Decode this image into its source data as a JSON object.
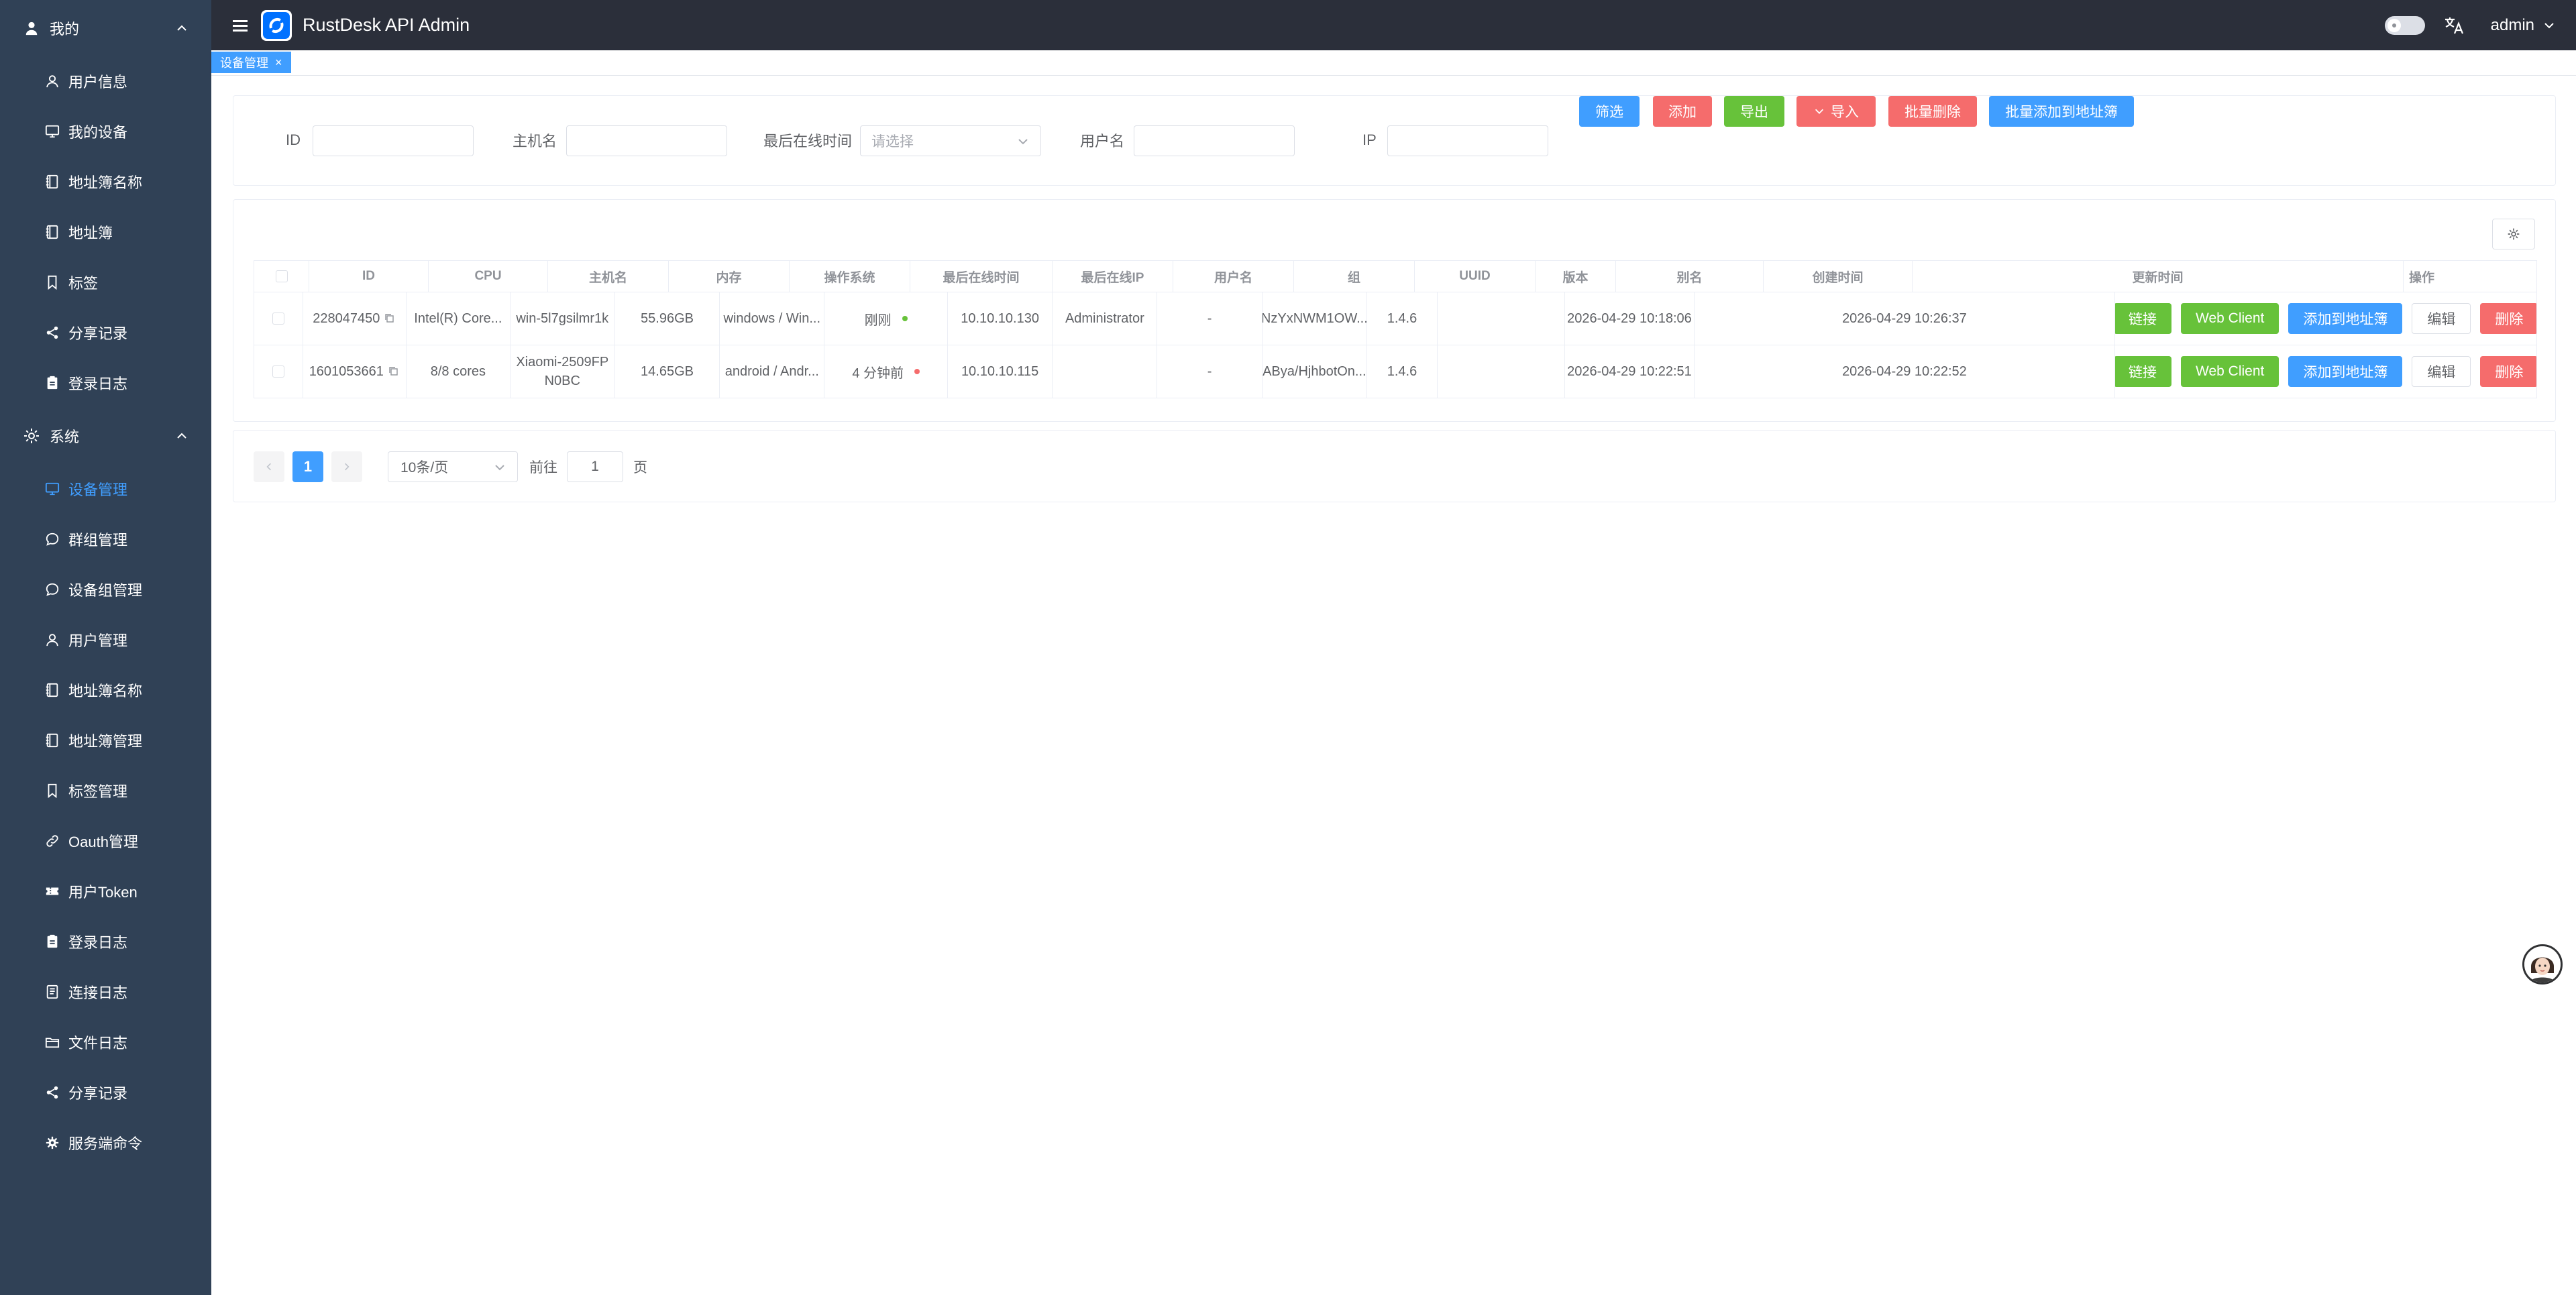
{
  "app": {
    "title": "RustDesk API Admin",
    "user": "admin"
  },
  "sidebar": {
    "group_me": "我的",
    "me_items": [
      {
        "label": "用户信息",
        "icon": "user-icon"
      },
      {
        "label": "我的设备",
        "icon": "monitor-icon"
      },
      {
        "label": "地址簿名称",
        "icon": "notebook-icon"
      },
      {
        "label": "地址簿",
        "icon": "notebook-icon"
      },
      {
        "label": "标签",
        "icon": "collection-tag-icon"
      },
      {
        "label": "分享记录",
        "icon": "share-icon"
      },
      {
        "label": "登录日志",
        "icon": "clipboard-icon"
      }
    ],
    "group_system": "系统",
    "system_items": [
      {
        "label": "设备管理",
        "icon": "monitor-icon",
        "active": true
      },
      {
        "label": "群组管理",
        "icon": "chat-icon"
      },
      {
        "label": "设备组管理",
        "icon": "chat-icon"
      },
      {
        "label": "用户管理",
        "icon": "user-icon"
      },
      {
        "label": "地址簿名称",
        "icon": "notebook-icon"
      },
      {
        "label": "地址簿管理",
        "icon": "notebook-icon"
      },
      {
        "label": "标签管理",
        "icon": "collection-tag-icon"
      },
      {
        "label": "Oauth管理",
        "icon": "link-icon"
      },
      {
        "label": "用户Token",
        "icon": "ticket-icon"
      },
      {
        "label": "登录日志",
        "icon": "clipboard-icon"
      },
      {
        "label": "连接日志",
        "icon": "document-icon"
      },
      {
        "label": "文件日志",
        "icon": "folder-icon"
      },
      {
        "label": "分享记录",
        "icon": "share-icon"
      },
      {
        "label": "服务端命令",
        "icon": "gear-icon"
      }
    ]
  },
  "tags": {
    "active": "设备管理",
    "close": "×"
  },
  "filter": {
    "id_label": "ID",
    "hostname_label": "主机名",
    "last_online_label": "最后在线时间",
    "last_online_placeholder": "请选择",
    "username_label": "用户名",
    "ip_label": "IP",
    "buttons": {
      "filter": "筛选",
      "add": "添加",
      "export": "导出",
      "import": "导入",
      "batch_delete": "批量删除",
      "batch_add_ab": "批量添加到地址簿"
    }
  },
  "table": {
    "headers": [
      "ID",
      "CPU",
      "主机名",
      "内存",
      "操作系统",
      "最后在线时间",
      "最后在线IP",
      "用户名",
      "组",
      "UUID",
      "版本",
      "别名",
      "创建时间",
      "更新时间",
      "操作"
    ],
    "rows": [
      {
        "id": "228047450",
        "cpu": "Intel(R) Core...",
        "hostname": "win-5l7gsilmr1k",
        "memory": "55.96GB",
        "os": "windows / Win...",
        "last_online": "刚刚",
        "status_color": "#67c23a",
        "last_ip": "10.10.10.130",
        "username": "Administrator",
        "group": "-",
        "uuid": "NzYxNWM1OW...",
        "version": "1.4.6",
        "alias": "",
        "created": "2026-04-29 10:18:06",
        "updated": "2026-04-29 10:26:37"
      },
      {
        "id": "1601053661",
        "cpu": "8/8 cores",
        "hostname": "Xiaomi-2509FPN0BC",
        "memory": "14.65GB",
        "os": "android / Andr...",
        "last_online": "4 分钟前",
        "status_color": "#f56c6c",
        "last_ip": "10.10.10.115",
        "username": "",
        "group": "-",
        "uuid": "ABya/HjhbotOn...",
        "version": "1.4.6",
        "alias": "",
        "created": "2026-04-29 10:22:51",
        "updated": "2026-04-29 10:22:52"
      }
    ],
    "actions": {
      "connect": "链接",
      "web_client": "Web Client",
      "add_to_ab": "添加到地址簿",
      "edit": "编辑",
      "delete": "删除"
    }
  },
  "pagination": {
    "current_page": "1",
    "page_size": "10条/页",
    "goto_label": "前往",
    "goto_value": "1",
    "page_suffix": "页"
  },
  "colors": {
    "primary": "#409eff",
    "danger": "#f56c6c",
    "success": "#67c23a",
    "sidebar_bg": "#304156",
    "header_bg": "#2b2f3a"
  }
}
